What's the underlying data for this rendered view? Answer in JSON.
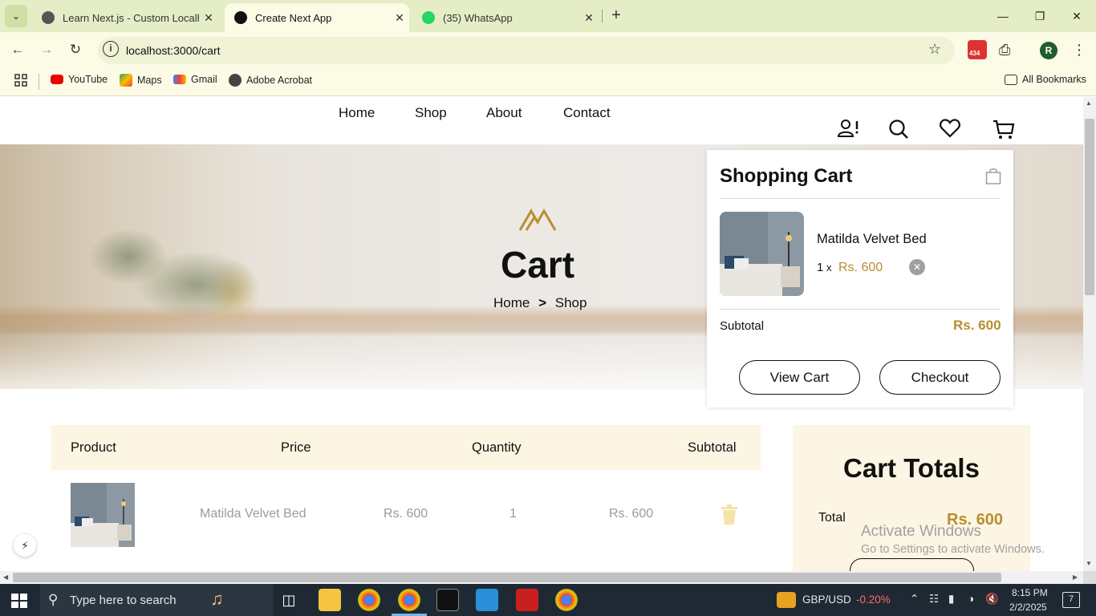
{
  "browser": {
    "tabs": [
      {
        "title": "Learn Next.js - Custom Localhost",
        "active": false
      },
      {
        "title": "Create Next App",
        "active": true
      },
      {
        "title": "(35) WhatsApp",
        "active": false
      }
    ],
    "address": "localhost:3000/cart",
    "extension_badge": "434",
    "profile_initial": "R",
    "bookmarks": [
      "YouTube",
      "Maps",
      "Gmail",
      "Adobe Acrobat"
    ],
    "all_bookmarks": "All Bookmarks"
  },
  "site": {
    "nav": [
      "Home",
      "Shop",
      "About",
      "Contact"
    ],
    "hero": {
      "title": "Cart",
      "crumb_home": "Home",
      "crumb_sep": ">",
      "crumb_current": "Shop"
    },
    "table": {
      "headers": [
        "Product",
        "Price",
        "Quantity",
        "Subtotal"
      ],
      "rows": [
        {
          "name": "Matilda Velvet Bed",
          "price": "Rs. 600",
          "quantity": "1",
          "subtotal": "Rs. 600"
        }
      ]
    },
    "totals": {
      "title": "Cart Totals",
      "total_label": "Total",
      "total_value": "Rs. 600"
    },
    "minicart": {
      "title": "Shopping Cart",
      "item": {
        "name": "Matilda Velvet Bed",
        "qty": "1",
        "times": "x",
        "price": "Rs. 600"
      },
      "subtotal_label": "Subtotal",
      "subtotal_value": "Rs. 600",
      "view_cart": "View Cart",
      "checkout": "Checkout"
    },
    "accent_color": "#b88e2f",
    "table_header_bg": "#fdf5e3"
  },
  "watermark": {
    "line1": "Activate Windows",
    "line2": "Go to Settings to activate Windows."
  },
  "taskbar": {
    "search_placeholder": "Type here to search",
    "ticker": "GBP/USD",
    "ticker_change": "-0.20%",
    "time": "8:15 PM",
    "date": "2/2/2025",
    "notifications": "7"
  }
}
